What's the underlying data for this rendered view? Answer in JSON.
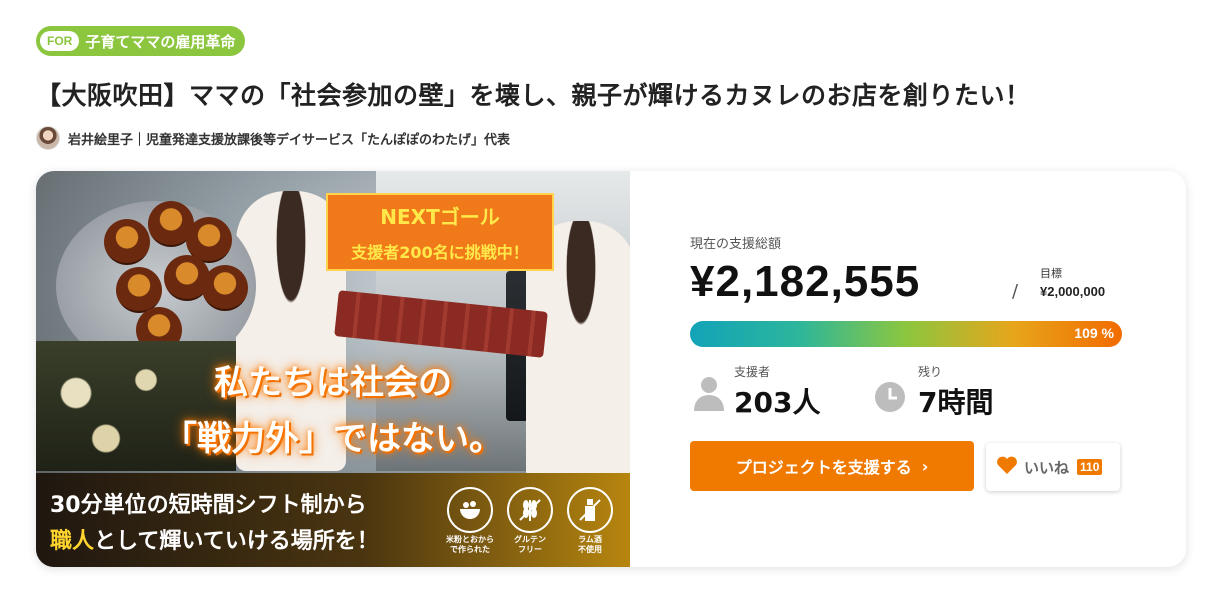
{
  "badge": {
    "tag": "FOR",
    "text": "子育てママの雇用革命"
  },
  "title": "【大阪吹田】ママの「社会参加の壁」を壊し、親子が輝けるカヌレのお店を創りたい！",
  "owner": {
    "text": "岩井絵里子｜児童発達支援放課後等デイサービス「たんぽぽのわたげ」代表"
  },
  "visual": {
    "next_line1": "NEXTゴール",
    "next_line2": "支援者200名に挑戦中！",
    "slogan_line1": "私たちは社会の",
    "slogan_line2": "「戦力外」ではない。",
    "banner_line1": "30分単位の短時間シフト制から",
    "banner_line2_highlight": "職人",
    "banner_line2_rest": "として輝いていける場所を！",
    "features": [
      {
        "icon": "rice-bowl-icon",
        "label1": "米粉とおから",
        "label2": "で作られた"
      },
      {
        "icon": "wheat-icon",
        "label1": "グルテン",
        "label2": "フリー"
      },
      {
        "icon": "bottle-icon",
        "label1": "ラム酒",
        "label2": "不使用"
      }
    ]
  },
  "stats": {
    "current_label": "現在の支援総額",
    "current_amount": "¥2,182,555",
    "goal_label": "目標",
    "goal_amount": "¥2,000,000",
    "progress_percent_text": "109 %",
    "progress_fraction": 1.0,
    "supporters_label": "支援者",
    "supporters_value": "203人",
    "remaining_label": "残り",
    "remaining_value": "7時間",
    "support_button": "プロジェクトを支援する",
    "like_label": "いいね",
    "like_count": "110"
  },
  "colors": {
    "accent": "#f07a00",
    "badge_green": "#8cc63f",
    "progress_start": "#12a3b8",
    "progress_end": "#f26b00"
  }
}
